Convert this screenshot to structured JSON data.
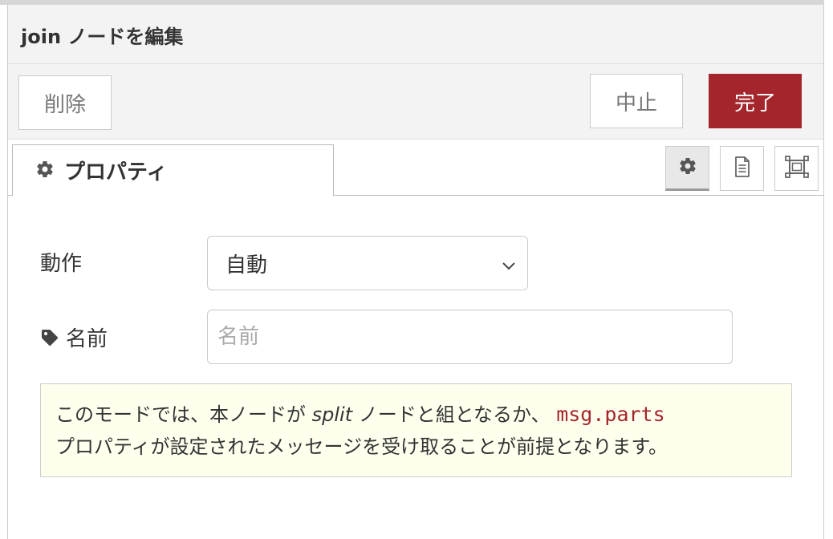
{
  "header": {
    "title": "join ノードを編集"
  },
  "buttons": {
    "delete": "削除",
    "cancel": "中止",
    "done": "完了"
  },
  "tabs": {
    "properties_label": "プロパティ",
    "icons": [
      "gear-icon",
      "description-icon",
      "appearance-icon"
    ]
  },
  "form": {
    "action_label": "動作",
    "action_value": "自動",
    "name_label": "名前",
    "name_placeholder": "名前",
    "name_value": ""
  },
  "tip": {
    "part1": "このモードでは、本ノードが ",
    "split": "split",
    "part2": " ノードと組となるか、 ",
    "code": "msg.parts",
    "part3": "プロパティが設定されたメッセージを受け取ることが前提となります。"
  },
  "colors": {
    "accent": "#a4262c",
    "tip_bg": "#ffffee",
    "bar_bg": "#f3f3f3"
  }
}
